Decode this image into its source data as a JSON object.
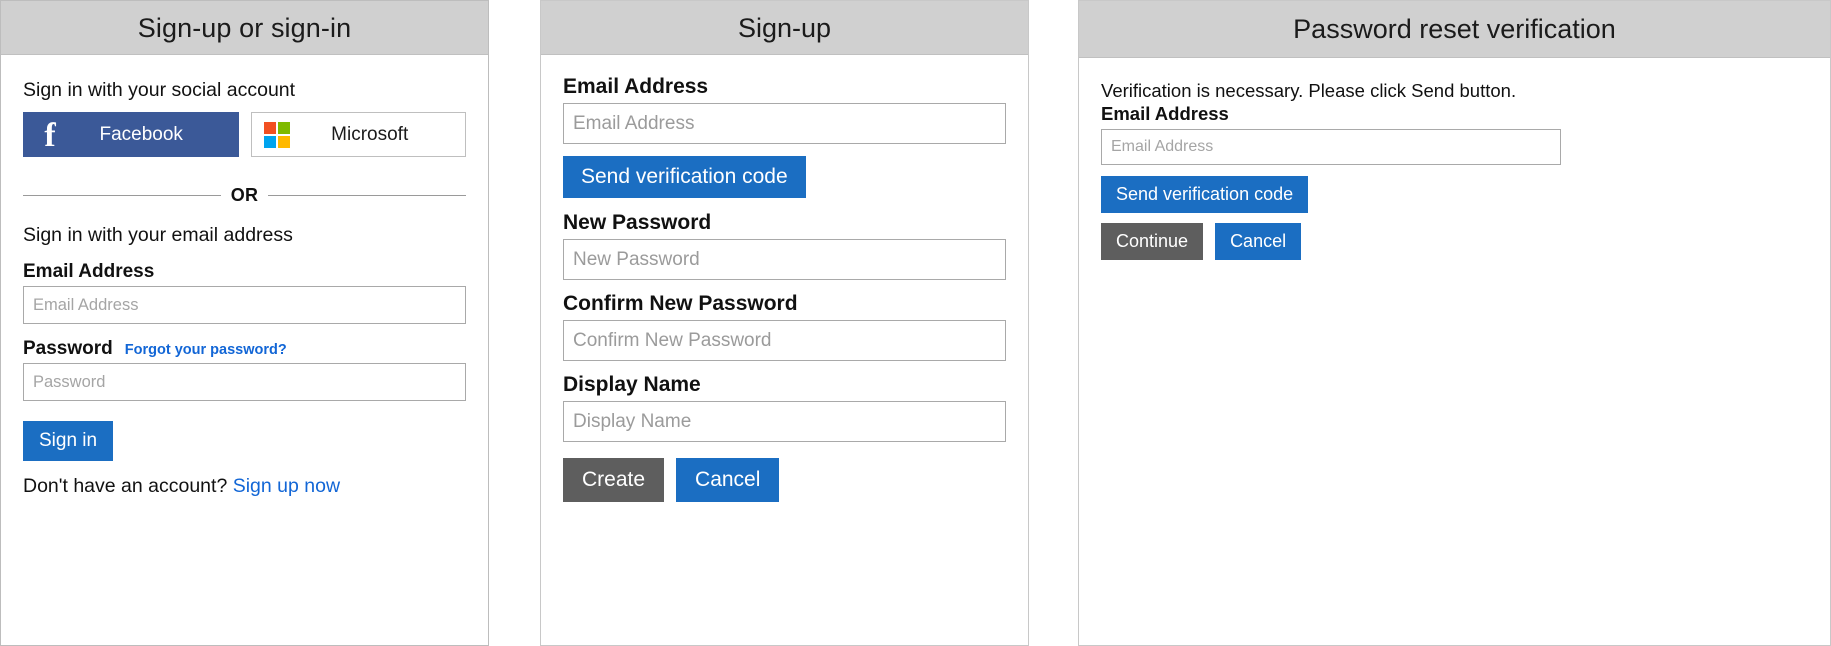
{
  "colors": {
    "header_bg": "#d0d0d0",
    "panel_border": "#c8c8c8",
    "primary_blue": "#1b6ec2",
    "link_blue": "#1266d6",
    "secondary_gray": "#5e5e5e",
    "facebook_blue": "#3b5998",
    "ms_red": "#f25022",
    "ms_green": "#7fba00",
    "ms_blue": "#00a4ef",
    "ms_yellow": "#ffb900",
    "placeholder_gray": "#a5a5a5"
  },
  "panel_signin": {
    "title": "Sign-up or sign-in",
    "social_heading": "Sign in with your social account",
    "facebook_label": "Facebook",
    "facebook_icon": "facebook-f-icon",
    "microsoft_label": "Microsoft",
    "microsoft_icon": "microsoft-squares-icon",
    "divider_text": "OR",
    "email_heading": "Sign in with your email address",
    "email_label": "Email Address",
    "email_placeholder": "Email Address",
    "email_value": "",
    "password_label": "Password",
    "forgot_link": "Forgot your password?",
    "password_placeholder": "Password",
    "password_value": "",
    "signin_button": "Sign in",
    "footer_text": "Don't have an account?",
    "footer_link": "Sign up now"
  },
  "panel_signup": {
    "title": "Sign-up",
    "email_label": "Email Address",
    "email_placeholder": "Email Address",
    "email_value": "",
    "send_code_button": "Send verification code",
    "new_password_label": "New Password",
    "new_password_placeholder": "New Password",
    "new_password_value": "",
    "confirm_password_label": "Confirm New Password",
    "confirm_password_placeholder": "Confirm New Password",
    "confirm_password_value": "",
    "display_name_label": "Display Name",
    "display_name_placeholder": "Display Name",
    "display_name_value": "",
    "create_button": "Create",
    "cancel_button": "Cancel"
  },
  "panel_reset": {
    "title": "Password reset verification",
    "note": "Verification is necessary. Please click Send button.",
    "email_label": "Email Address",
    "email_placeholder": "Email Address",
    "email_value": "",
    "send_code_button": "Send verification code",
    "continue_button": "Continue",
    "cancel_button": "Cancel"
  }
}
